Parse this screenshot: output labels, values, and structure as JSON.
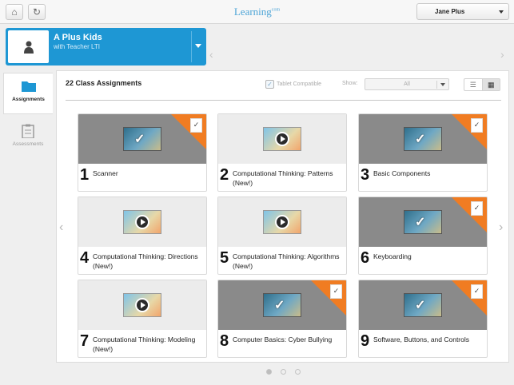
{
  "topbar": {
    "logo": "Learning",
    "logo_sup": "com",
    "user": "Jane Plus"
  },
  "class": {
    "title": "A Plus Kids",
    "subtitle": "with Teacher LTI"
  },
  "sidebar": {
    "items": [
      {
        "label": "Assignments"
      },
      {
        "label": "Assessments"
      }
    ]
  },
  "panel": {
    "title": "22 Class Assignments",
    "tablet_label": "Tablet Compatible",
    "show_label": "Show:",
    "show_value": "All"
  },
  "tiles": [
    {
      "num": "1",
      "title": "Scanner",
      "kind": "assessment"
    },
    {
      "num": "2",
      "title": "Computational Thinking: Patterns (New!)",
      "kind": "video"
    },
    {
      "num": "3",
      "title": "Basic Components",
      "kind": "assessment"
    },
    {
      "num": "4",
      "title": "Computational Thinking: Directions (New!)",
      "kind": "video"
    },
    {
      "num": "5",
      "title": "Computational Thinking: Algorithms (New!)",
      "kind": "video"
    },
    {
      "num": "6",
      "title": "Keyboarding",
      "kind": "assessment"
    },
    {
      "num": "7",
      "title": "Computational Thinking: Modeling (New!)",
      "kind": "video"
    },
    {
      "num": "8",
      "title": "Computer Basics: Cyber Bullying",
      "kind": "assessment"
    },
    {
      "num": "9",
      "title": "Software, Buttons, and Controls",
      "kind": "assessment"
    }
  ],
  "icons": {
    "home": "home-icon",
    "refresh": "refresh-icon",
    "folder": "folder-icon",
    "clipboard": "clipboard-icon",
    "list": "list-view-icon",
    "grid": "grid-view-icon",
    "play": "play-icon",
    "check": "checkmark-icon"
  },
  "colors": {
    "accent": "#1e97d4",
    "badge": "#f07c22"
  },
  "pagination": {
    "pages": 3,
    "current": 1
  }
}
